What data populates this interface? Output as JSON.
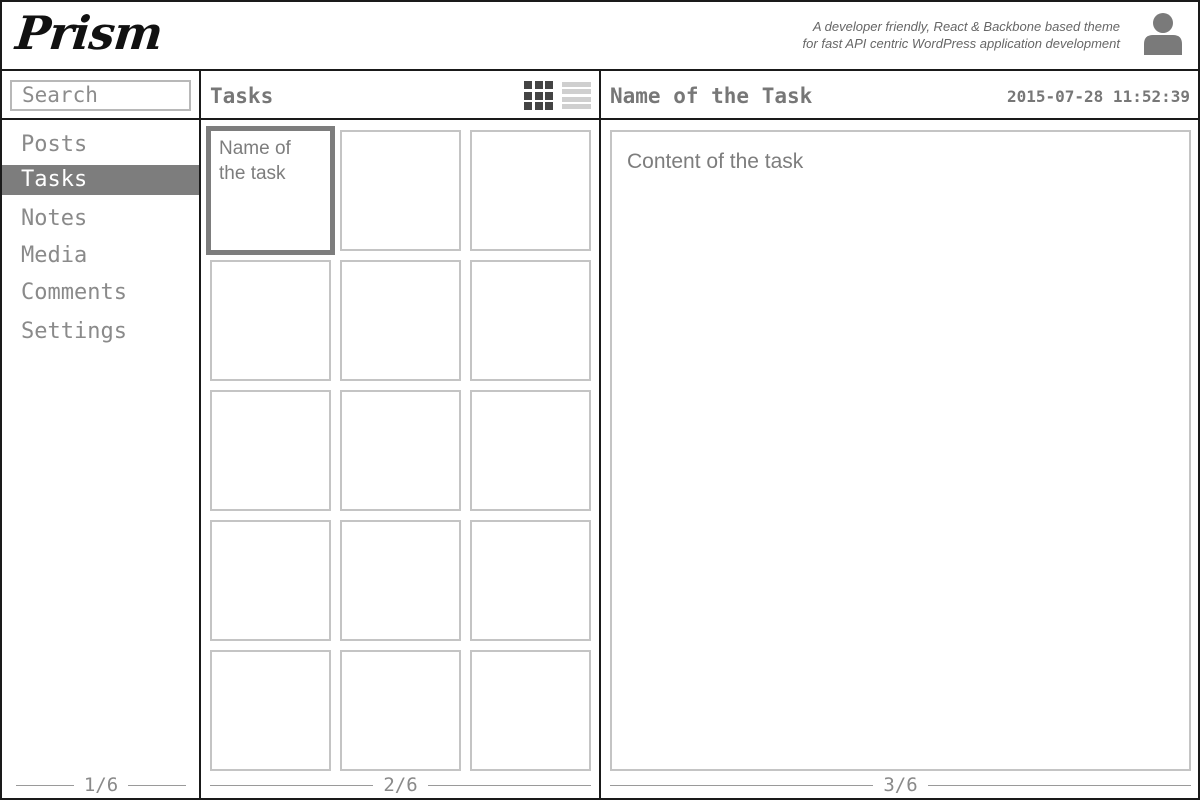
{
  "header": {
    "logo": "Prism",
    "tagline_line1": "A developer friendly, React & Backbone based theme",
    "tagline_line2": "for fast API centric WordPress application development",
    "avatar_icon": "user-avatar-icon"
  },
  "sidebar": {
    "search_placeholder": "Search",
    "items": [
      {
        "label": "Posts",
        "active": false
      },
      {
        "label": "Tasks",
        "active": true
      },
      {
        "label": "Notes",
        "active": false
      },
      {
        "label": "Media",
        "active": false
      },
      {
        "label": "Comments",
        "active": false
      },
      {
        "label": "Settings",
        "active": false
      }
    ],
    "pager": "1/6"
  },
  "list": {
    "title": "Tasks",
    "view_options": [
      "grid-view-icon",
      "list-view-icon"
    ],
    "active_view": "grid",
    "selected_tile_label": "Name of the task",
    "tile_count": 15,
    "pager": "2/6"
  },
  "detail": {
    "title": "Name of the Task",
    "timestamp": "2015-07-28 11:52:39",
    "content": "Content of the task",
    "pager": "3/6"
  },
  "colors": {
    "border": "#1a1a1a",
    "active_nav_bg": "#7d7d7d",
    "muted_text": "#8a8a8a",
    "tile_border": "#c4c4c4"
  }
}
